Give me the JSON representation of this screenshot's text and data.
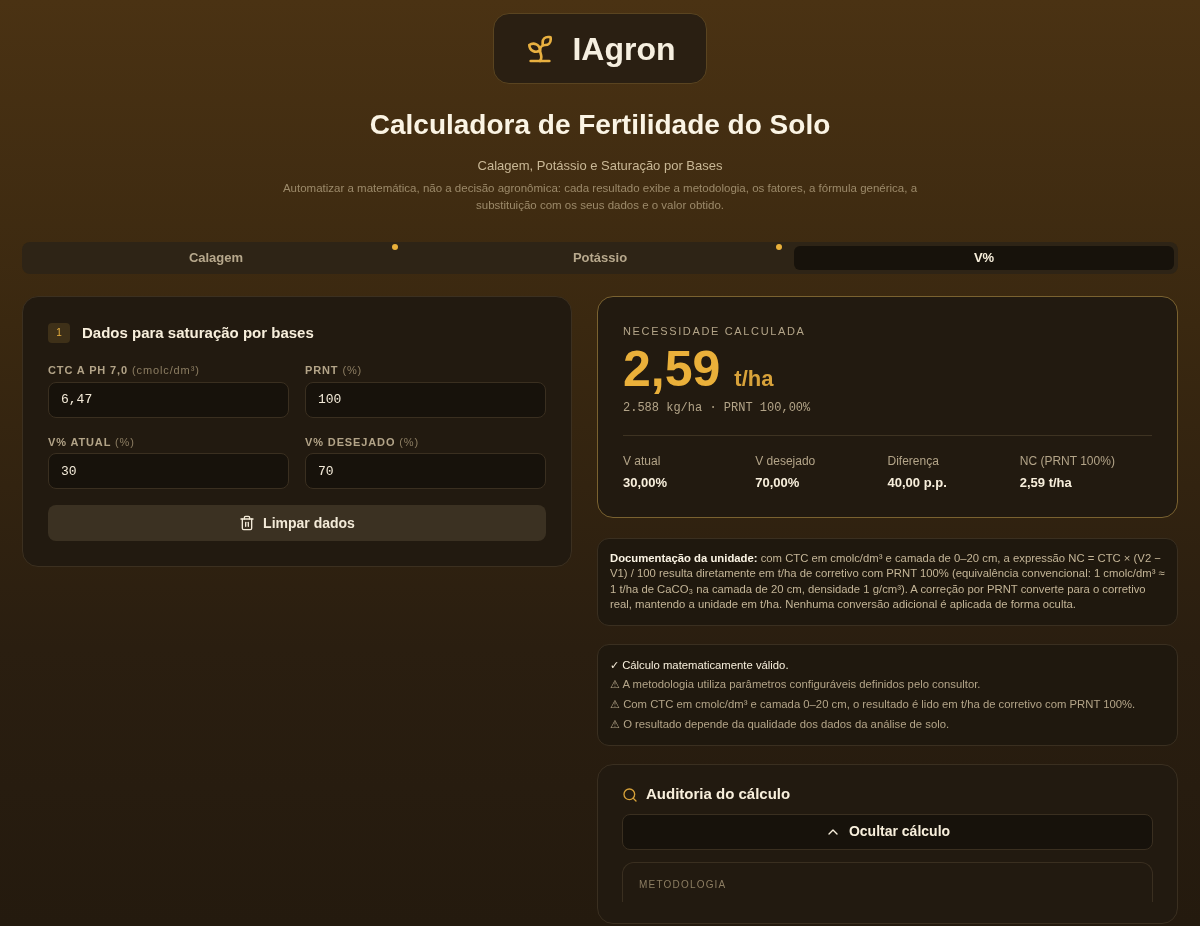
{
  "brand": {
    "name": "IAgron"
  },
  "header": {
    "title": "Calculadora de Fertilidade do Solo",
    "subtitle": "Calagem, Potássio e Saturação por Bases",
    "description": "Automatizar a matemática, não a decisão agronômica: cada resultado exibe a metodologia, os fatores, a fórmula genérica, a substituição com os seus dados e o valor obtido."
  },
  "tabs": [
    {
      "label": "Calagem",
      "selected": false,
      "dot": true
    },
    {
      "label": "Potássio",
      "selected": false,
      "dot": true
    },
    {
      "label": "V%",
      "selected": true,
      "dot": false
    }
  ],
  "input_card": {
    "step": "1",
    "title": "Dados para saturação por bases",
    "fields": [
      {
        "label": "CTC A PH 7,0",
        "unit": "(cmolc/dm³)",
        "value": "6,47"
      },
      {
        "label": "PRNT",
        "unit": "(%)",
        "value": "100"
      },
      {
        "label": "V% ATUAL",
        "unit": "(%)",
        "value": "30"
      },
      {
        "label": "V% DESEJADO",
        "unit": "(%)",
        "value": "70"
      }
    ],
    "clear_button": "Limpar dados"
  },
  "result": {
    "label": "NECESSIDADE CALCULADA",
    "value": "2,59",
    "unit": "t/ha",
    "detail": "2.588 kg/ha · PRNT 100,00%",
    "stats": [
      {
        "label": "V atual",
        "value": "30,00%"
      },
      {
        "label": "V desejado",
        "value": "70,00%"
      },
      {
        "label": "Diferença",
        "value": "40,00 p.p."
      },
      {
        "label": "NC (PRNT 100%)",
        "value": "2,59 t/ha"
      }
    ]
  },
  "unit_note": "**Documentação da unidade:** com CTC em cmolc/dm³ e camada de 0–20 cm, a expressão NC = CTC × (V2 − V1) / 100 resulta diretamente em t/ha de corretivo com PRNT 100% (equivalência convencional: 1 cmolc/dm³ ≈ 1 t/ha de CaCO₃ na camada de 20 cm, densidade 1 g/cm³). A correção por PRNT converte para o corretivo real, mantendo a unidade em t/ha. Nenhuma conversão adicional é aplicada de forma oculta.",
  "checks": [
    {
      "kind": "ok",
      "text": "✓ Cálculo matematicamente válido."
    },
    {
      "kind": "warning",
      "text": "⚠ A metodologia utiliza parâmetros configuráveis definidos pelo consultor."
    },
    {
      "kind": "warning",
      "text": "⚠ Com CTC em cmolc/dm³ e camada 0–20 cm, o resultado é lido em t/ha de corretivo com PRNT 100%."
    },
    {
      "kind": "warning",
      "text": "⚠ O resultado depende da qualidade dos dados da análise de solo."
    }
  ],
  "audit": {
    "title": "Auditoria do cálculo",
    "toggle": {
      "label": "Ocultar cálculo",
      "expanded": true
    },
    "section_label": "METODOLOGIA"
  }
}
